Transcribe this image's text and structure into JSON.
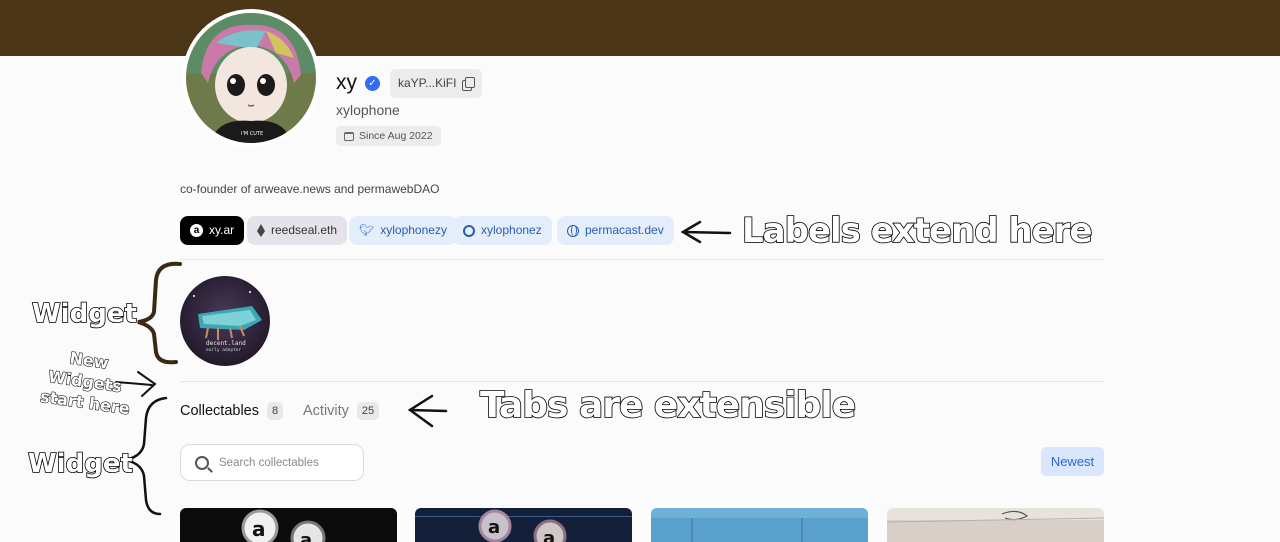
{
  "profile": {
    "name": "xy",
    "address_short": "kaYP...KiFI",
    "handle": "xylophone",
    "since": "Since Aug 2022",
    "bio": "co-founder of arweave.news and permawebDAO"
  },
  "links": [
    {
      "label": "xy.ar",
      "icon": "arweave-icon"
    },
    {
      "label": "reedseal.eth",
      "icon": "ethereum-icon"
    },
    {
      "label": "xylophonezy",
      "icon": "twitter-icon"
    },
    {
      "label": "xylophonez",
      "icon": "github-icon"
    },
    {
      "label": "permacast.dev",
      "icon": "globe-icon"
    }
  ],
  "widget": {
    "badge_line1": "decent.land",
    "badge_line2": "early adopter"
  },
  "tabs": [
    {
      "label": "Collectables",
      "count": "8"
    },
    {
      "label": "Activity",
      "count": "25"
    }
  ],
  "search": {
    "placeholder": "Search collectables"
  },
  "sort": {
    "label": "Newest"
  },
  "annotations": {
    "labels": "Labels extend here",
    "tabs": "Tabs are extensible",
    "widget_top": "Widget",
    "widget_bottom": "Widget",
    "new_widgets_1": "New",
    "new_widgets_2": "Widgets",
    "new_widgets_3": "start here"
  },
  "colors": {
    "banner": "#4c3618",
    "accent": "#2a6ad4",
    "verified": "#2f6df6"
  }
}
